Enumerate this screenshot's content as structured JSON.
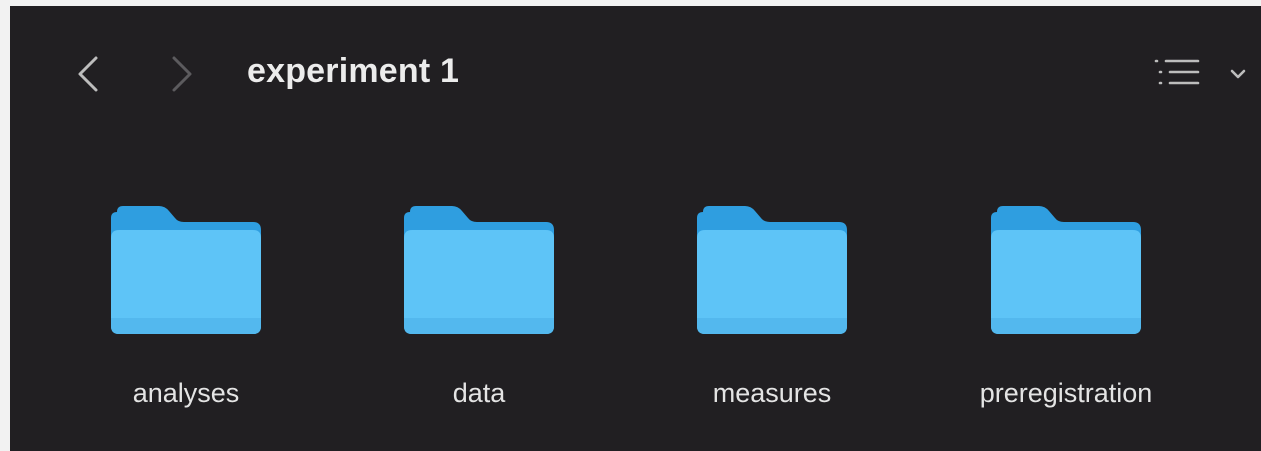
{
  "window": {
    "title": "experiment 1",
    "background": "#211f22"
  },
  "toolbar": {
    "back_icon": "chevron-left-icon",
    "forward_icon": "chevron-right-icon",
    "view_icon": "list-view-icon",
    "view_menu_icon": "chevron-down-icon"
  },
  "folder_color": "#5ec4f7",
  "items": [
    {
      "label": "analyses",
      "icon": "folder-icon"
    },
    {
      "label": "data",
      "icon": "folder-icon"
    },
    {
      "label": "measures",
      "icon": "folder-icon"
    },
    {
      "label": "preregistration",
      "icon": "folder-icon"
    }
  ]
}
